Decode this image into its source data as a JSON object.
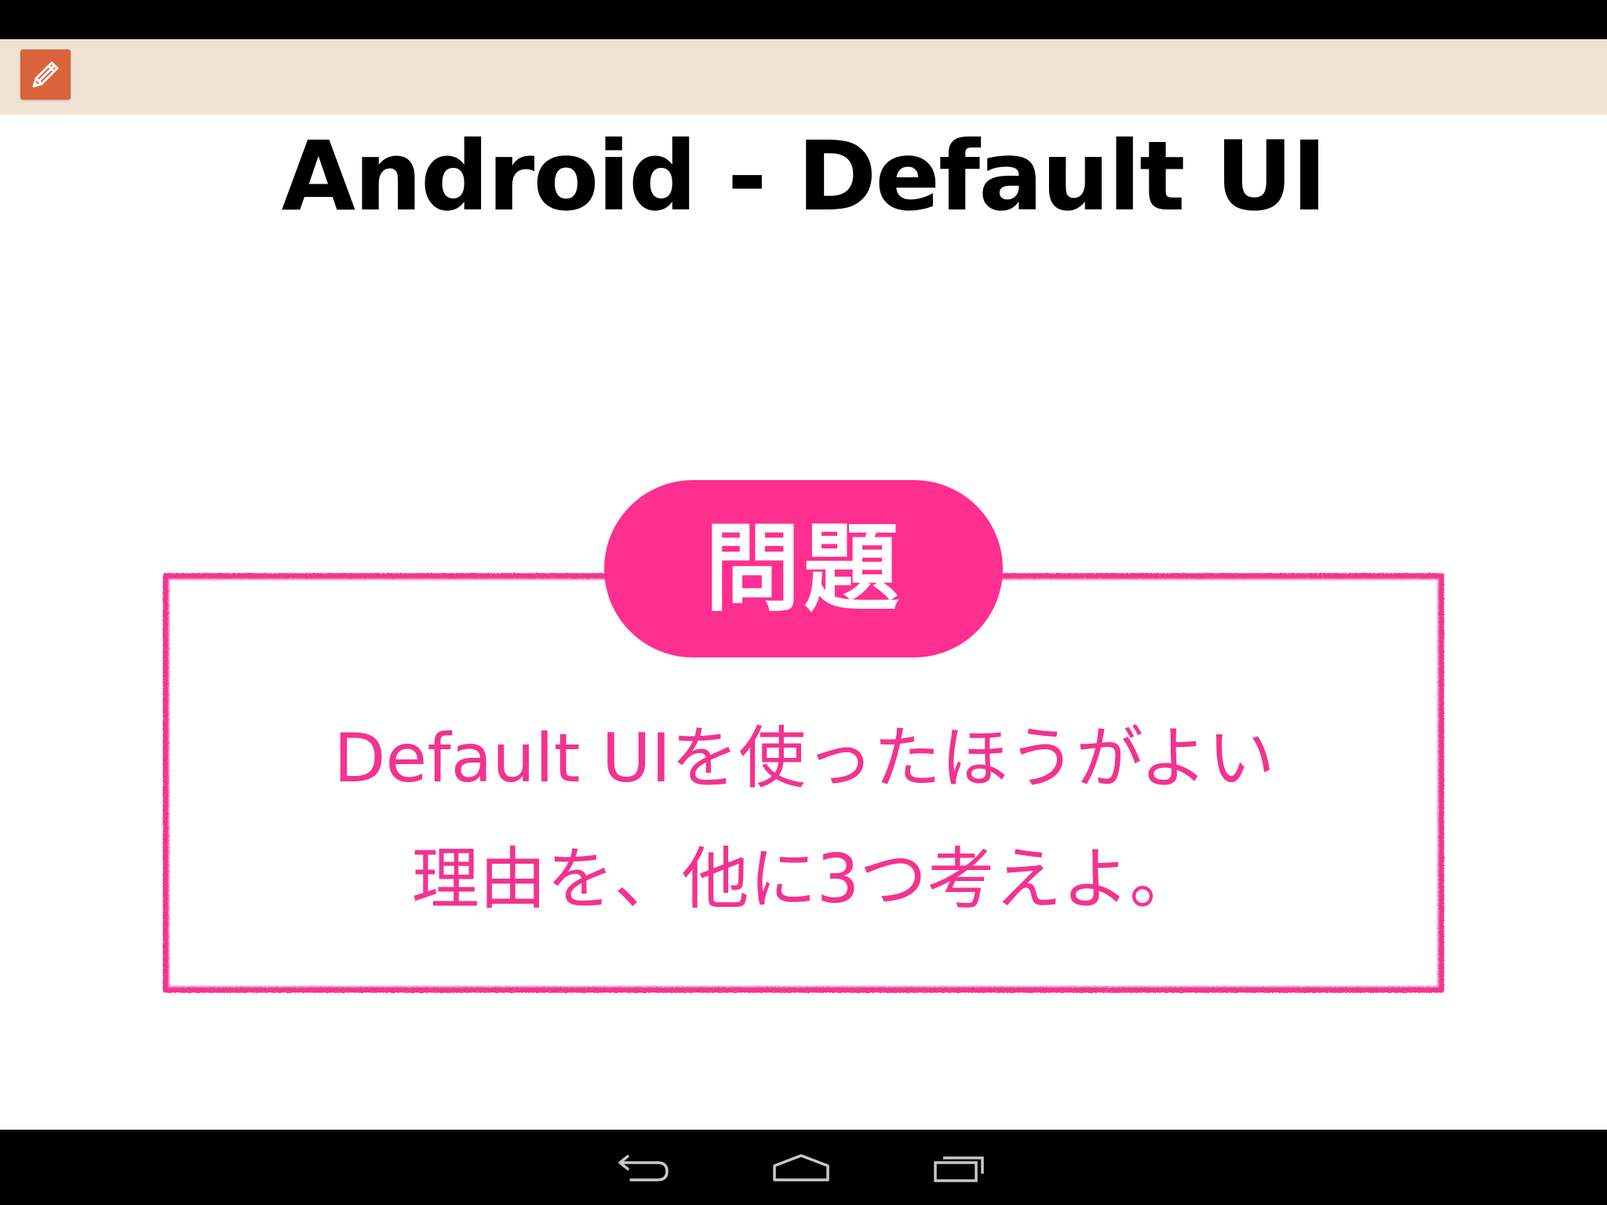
{
  "app_bar": {
    "icon": "pencil-icon",
    "background": "#efe2d3",
    "icon_color": "#d9633b"
  },
  "slide": {
    "title": "Android - Default UI",
    "badge_label": "問題",
    "question_lines": [
      "Default UIを使ったほうがよい",
      "理由を、他に3つ考えよ。"
    ],
    "accent_color": "#ff2f8f"
  },
  "nav_bar": {
    "buttons": [
      "back-icon",
      "home-icon",
      "recent-apps-icon"
    ]
  }
}
